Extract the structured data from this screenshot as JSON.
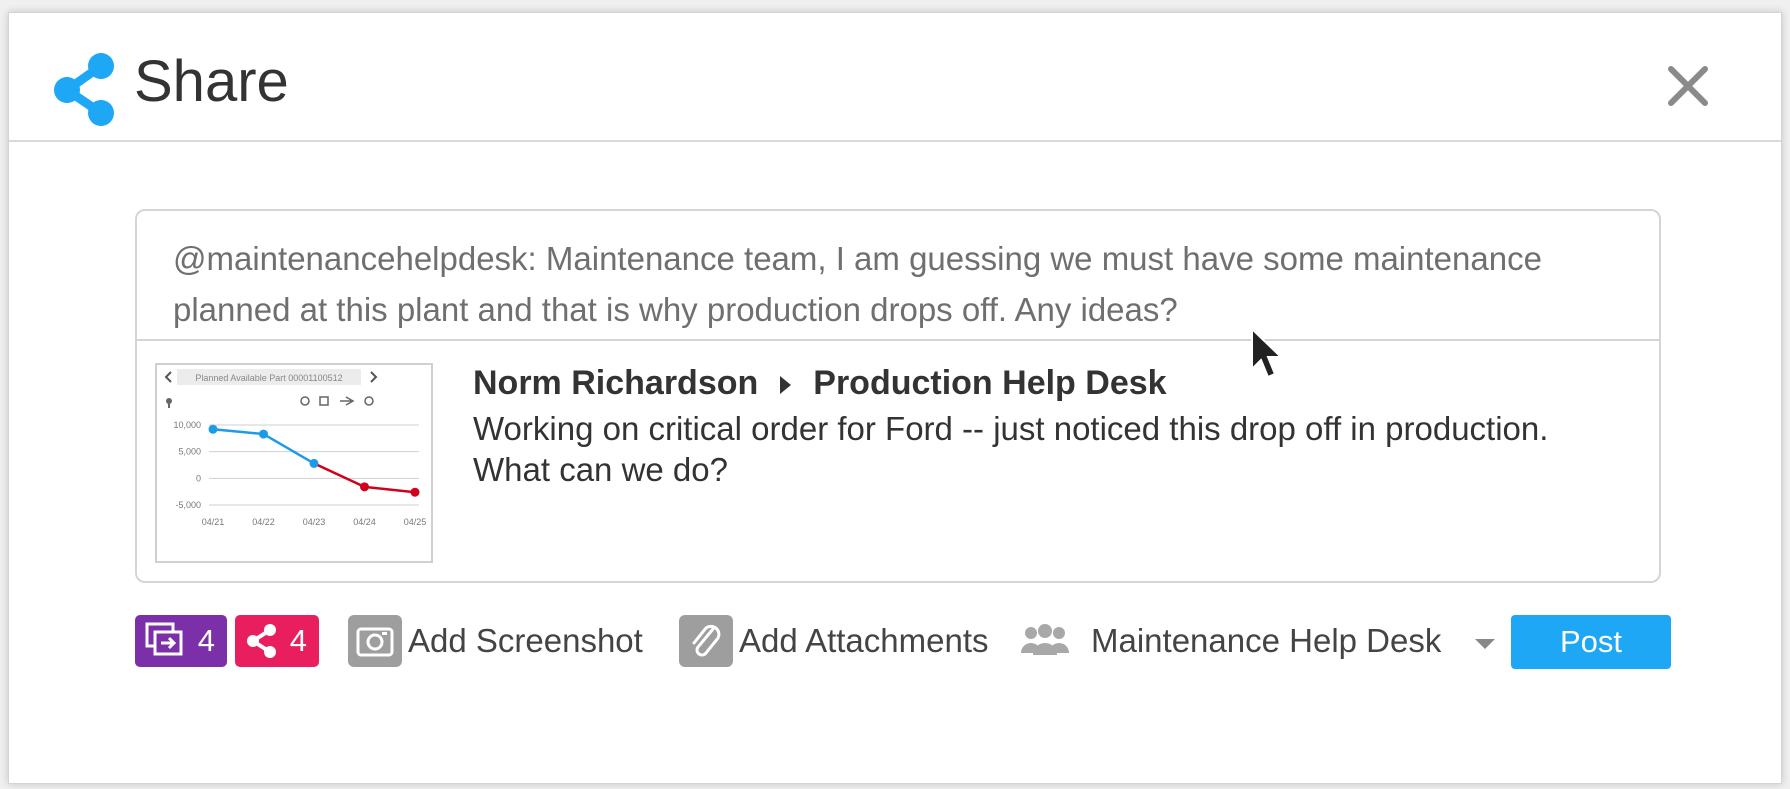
{
  "dialog": {
    "title": "Share",
    "icons": {
      "title": "share-icon",
      "close": "close-icon"
    },
    "accent_color": "#1ea7f5"
  },
  "post": {
    "message": "@maintenancehelpdesk: Maintenance team, I am guessing we must have some maintenance planned at this plant and that is why production drops off. Any ideas?",
    "shared": {
      "author": "Norm Richardson",
      "group": "Production Help Desk",
      "body": "Working on critical order for Ford -- just noticed this drop off in production. What can we do?"
    }
  },
  "thumbnail": {
    "header": "Planned Available Part 00001100512",
    "chart_data": {
      "type": "line",
      "categories": [
        "04/21",
        "04/22",
        "04/23",
        "04/24",
        "04/25"
      ],
      "values": [
        9200,
        8300,
        2800,
        -1600,
        -2600
      ],
      "y_ticks": [
        "10,000",
        "5,000",
        "0",
        "-5,000"
      ],
      "ylim": [
        -5000,
        10000
      ],
      "colors": {
        "rising": "#1e9be8",
        "drop": "#d0021b"
      },
      "grid": true
    }
  },
  "toolbar": {
    "badges": [
      {
        "count": "4",
        "icon": "screens-icon",
        "color": "#7b2fa8"
      },
      {
        "count": "4",
        "icon": "share-icon",
        "color": "#e91e5e"
      }
    ],
    "add_screenshot": "Add Screenshot",
    "add_attachments": "Add Attachments",
    "group_select": "Maintenance Help Desk",
    "post_label": "Post"
  }
}
